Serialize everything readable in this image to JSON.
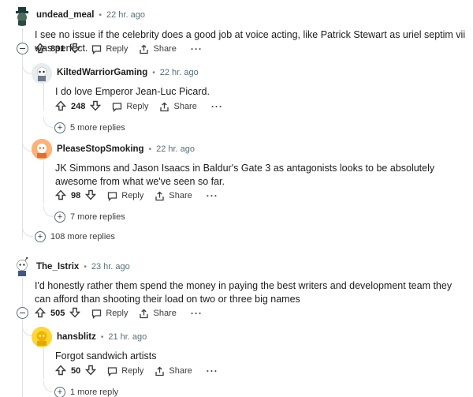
{
  "comments": [
    {
      "author": "undead_meal",
      "time": "22 hr. ago",
      "text": "I see no issue if the celebrity does a good job at voice acting, like Patrick Stewart as uriel septim vii was perfect.",
      "score": "831"
    },
    {
      "author": "KiltedWarriorGaming",
      "time": "22 hr. ago",
      "text": "I do love Emperor Jean-Luc Picard.",
      "score": "248",
      "more": "5 more replies"
    },
    {
      "author": "PleaseStopSmoking",
      "time": "22 hr. ago",
      "text": "JK Simmons and Jason Isaacs in Baldur's Gate 3 as antagonists looks to be absolutely awesome from what we've seen so far.",
      "score": "98",
      "more": "7 more replies"
    },
    {
      "more": "108 more replies"
    },
    {
      "author": "The_Istrix",
      "time": "23 hr. ago",
      "text": "I'd honestly rather them spend the money in paying the best writers and development team they can afford than shooting their load on two or three big names",
      "score": "505"
    },
    {
      "author": "hansblitz",
      "time": "21 hr. ago",
      "text": "Forgot sandwich artists",
      "score": "50",
      "more": "1 more reply"
    }
  ],
  "labels": {
    "reply": "Reply",
    "share": "Share",
    "more": "···",
    "separator": "•"
  },
  "colors": {
    "avatar_gray": "#d7dadc",
    "avatar_orange": "#ff8717",
    "avatar_yellow": "#ffd635"
  }
}
